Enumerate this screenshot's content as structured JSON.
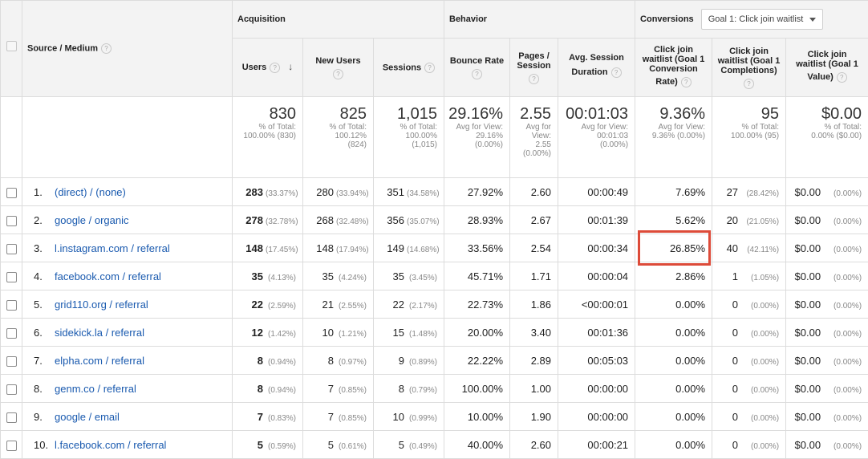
{
  "header": {
    "source_medium": "Source / Medium",
    "groups": {
      "acquisition": "Acquisition",
      "behavior": "Behavior",
      "conversions": "Conversions"
    },
    "goal_select": {
      "value": "Goal 1: Click join waitlist"
    },
    "columns": {
      "users": "Users",
      "new_users": "New Users",
      "sessions": "Sessions",
      "bounce_rate": "Bounce Rate",
      "pages_session_1": "Pages /",
      "pages_session_2": "Session",
      "avg_session_1": "Avg. Session",
      "avg_session_2": "Duration",
      "conv_rate_1": "Click join",
      "conv_rate_2": "waitlist (Goal 1",
      "conv_rate_3": "Conversion",
      "conv_rate_4": "Rate)",
      "completions_1": "Click join",
      "completions_2": "waitlist (Goal 1",
      "completions_3": "Completions)",
      "value_1": "Click join",
      "value_2": "waitlist (Goal 1",
      "value_3": "Value)"
    },
    "help_glyph": "?",
    "sort_glyph": "↓"
  },
  "totals": {
    "users": {
      "value": "830",
      "l1": "% of Total:",
      "l2": "100.00% (830)"
    },
    "new_users": {
      "value": "825",
      "l1": "% of Total:",
      "l2": "100.12%",
      "l3": "(824)"
    },
    "sessions": {
      "value": "1,015",
      "l1": "% of Total:",
      "l2": "100.00%",
      "l3": "(1,015)"
    },
    "bounce_rate": {
      "value": "29.16%",
      "l1": "Avg for View:",
      "l2": "29.16%",
      "l3": "(0.00%)"
    },
    "pages_session": {
      "value": "2.55",
      "l1": "Avg for",
      "l2": "View:",
      "l3": "2.55",
      "l4": "(0.00%)"
    },
    "avg_duration": {
      "value": "00:01:03",
      "l1": "Avg for View:",
      "l2": "00:01:03",
      "l3": "(0.00%)"
    },
    "conv_rate": {
      "value": "9.36%",
      "l1": "Avg for View:",
      "l2": "9.36% (0.00%)"
    },
    "completions": {
      "value": "95",
      "l1": "% of Total:",
      "l2": "100.00% (95)"
    },
    "goal_value": {
      "value": "$0.00",
      "l1": "% of Total:",
      "l2": "0.00% ($0.00)"
    }
  },
  "rows": [
    {
      "idx": "1.",
      "source": "(direct) / (none)",
      "users": "283",
      "users_pct": "(33.37%)",
      "new_users": "280",
      "new_users_pct": "(33.94%)",
      "sessions": "351",
      "sessions_pct": "(34.58%)",
      "bounce": "27.92%",
      "pages": "2.60",
      "duration": "00:00:49",
      "conv_rate": "7.69%",
      "completions": "27",
      "completions_pct": "(28.42%)",
      "value": "$0.00",
      "value_pct": "(0.00%)"
    },
    {
      "idx": "2.",
      "source": "google / organic",
      "users": "278",
      "users_pct": "(32.78%)",
      "new_users": "268",
      "new_users_pct": "(32.48%)",
      "sessions": "356",
      "sessions_pct": "(35.07%)",
      "bounce": "28.93%",
      "pages": "2.67",
      "duration": "00:01:39",
      "conv_rate": "5.62%",
      "completions": "20",
      "completions_pct": "(21.05%)",
      "value": "$0.00",
      "value_pct": "(0.00%)"
    },
    {
      "idx": "3.",
      "source": "l.instagram.com / referral",
      "users": "148",
      "users_pct": "(17.45%)",
      "new_users": "148",
      "new_users_pct": "(17.94%)",
      "sessions": "149",
      "sessions_pct": "(14.68%)",
      "bounce": "33.56%",
      "pages": "2.54",
      "duration": "00:00:34",
      "conv_rate": "26.85%",
      "completions": "40",
      "completions_pct": "(42.11%)",
      "value": "$0.00",
      "value_pct": "(0.00%)"
    },
    {
      "idx": "4.",
      "source": "facebook.com / referral",
      "users": "35",
      "users_pct": "(4.13%)",
      "new_users": "35",
      "new_users_pct": "(4.24%)",
      "sessions": "35",
      "sessions_pct": "(3.45%)",
      "bounce": "45.71%",
      "pages": "1.71",
      "duration": "00:00:04",
      "conv_rate": "2.86%",
      "completions": "1",
      "completions_pct": "(1.05%)",
      "value": "$0.00",
      "value_pct": "(0.00%)"
    },
    {
      "idx": "5.",
      "source": "grid110.org / referral",
      "users": "22",
      "users_pct": "(2.59%)",
      "new_users": "21",
      "new_users_pct": "(2.55%)",
      "sessions": "22",
      "sessions_pct": "(2.17%)",
      "bounce": "22.73%",
      "pages": "1.86",
      "duration": "<00:00:01",
      "conv_rate": "0.00%",
      "completions": "0",
      "completions_pct": "(0.00%)",
      "value": "$0.00",
      "value_pct": "(0.00%)"
    },
    {
      "idx": "6.",
      "source": "sidekick.la / referral",
      "users": "12",
      "users_pct": "(1.42%)",
      "new_users": "10",
      "new_users_pct": "(1.21%)",
      "sessions": "15",
      "sessions_pct": "(1.48%)",
      "bounce": "20.00%",
      "pages": "3.40",
      "duration": "00:01:36",
      "conv_rate": "0.00%",
      "completions": "0",
      "completions_pct": "(0.00%)",
      "value": "$0.00",
      "value_pct": "(0.00%)"
    },
    {
      "idx": "7.",
      "source": "elpha.com / referral",
      "users": "8",
      "users_pct": "(0.94%)",
      "new_users": "8",
      "new_users_pct": "(0.97%)",
      "sessions": "9",
      "sessions_pct": "(0.89%)",
      "bounce": "22.22%",
      "pages": "2.89",
      "duration": "00:05:03",
      "conv_rate": "0.00%",
      "completions": "0",
      "completions_pct": "(0.00%)",
      "value": "$0.00",
      "value_pct": "(0.00%)"
    },
    {
      "idx": "8.",
      "source": "genm.co / referral",
      "users": "8",
      "users_pct": "(0.94%)",
      "new_users": "7",
      "new_users_pct": "(0.85%)",
      "sessions": "8",
      "sessions_pct": "(0.79%)",
      "bounce": "100.00%",
      "pages": "1.00",
      "duration": "00:00:00",
      "conv_rate": "0.00%",
      "completions": "0",
      "completions_pct": "(0.00%)",
      "value": "$0.00",
      "value_pct": "(0.00%)"
    },
    {
      "idx": "9.",
      "source": "google / email",
      "users": "7",
      "users_pct": "(0.83%)",
      "new_users": "7",
      "new_users_pct": "(0.85%)",
      "sessions": "10",
      "sessions_pct": "(0.99%)",
      "bounce": "10.00%",
      "pages": "1.90",
      "duration": "00:00:00",
      "conv_rate": "0.00%",
      "completions": "0",
      "completions_pct": "(0.00%)",
      "value": "$0.00",
      "value_pct": "(0.00%)"
    },
    {
      "idx": "10.",
      "source": "l.facebook.com / referral",
      "users": "5",
      "users_pct": "(0.59%)",
      "new_users": "5",
      "new_users_pct": "(0.61%)",
      "sessions": "5",
      "sessions_pct": "(0.49%)",
      "bounce": "40.00%",
      "pages": "2.60",
      "duration": "00:00:21",
      "conv_rate": "0.00%",
      "completions": "0",
      "completions_pct": "(0.00%)",
      "value": "$0.00",
      "value_pct": "(0.00%)"
    }
  ],
  "highlight": {
    "row": 2,
    "column": "conv_rate",
    "color": "#dd4b39"
  },
  "colors": {
    "link": "#1a5aaf",
    "header_bg": "#f3f3f3"
  }
}
